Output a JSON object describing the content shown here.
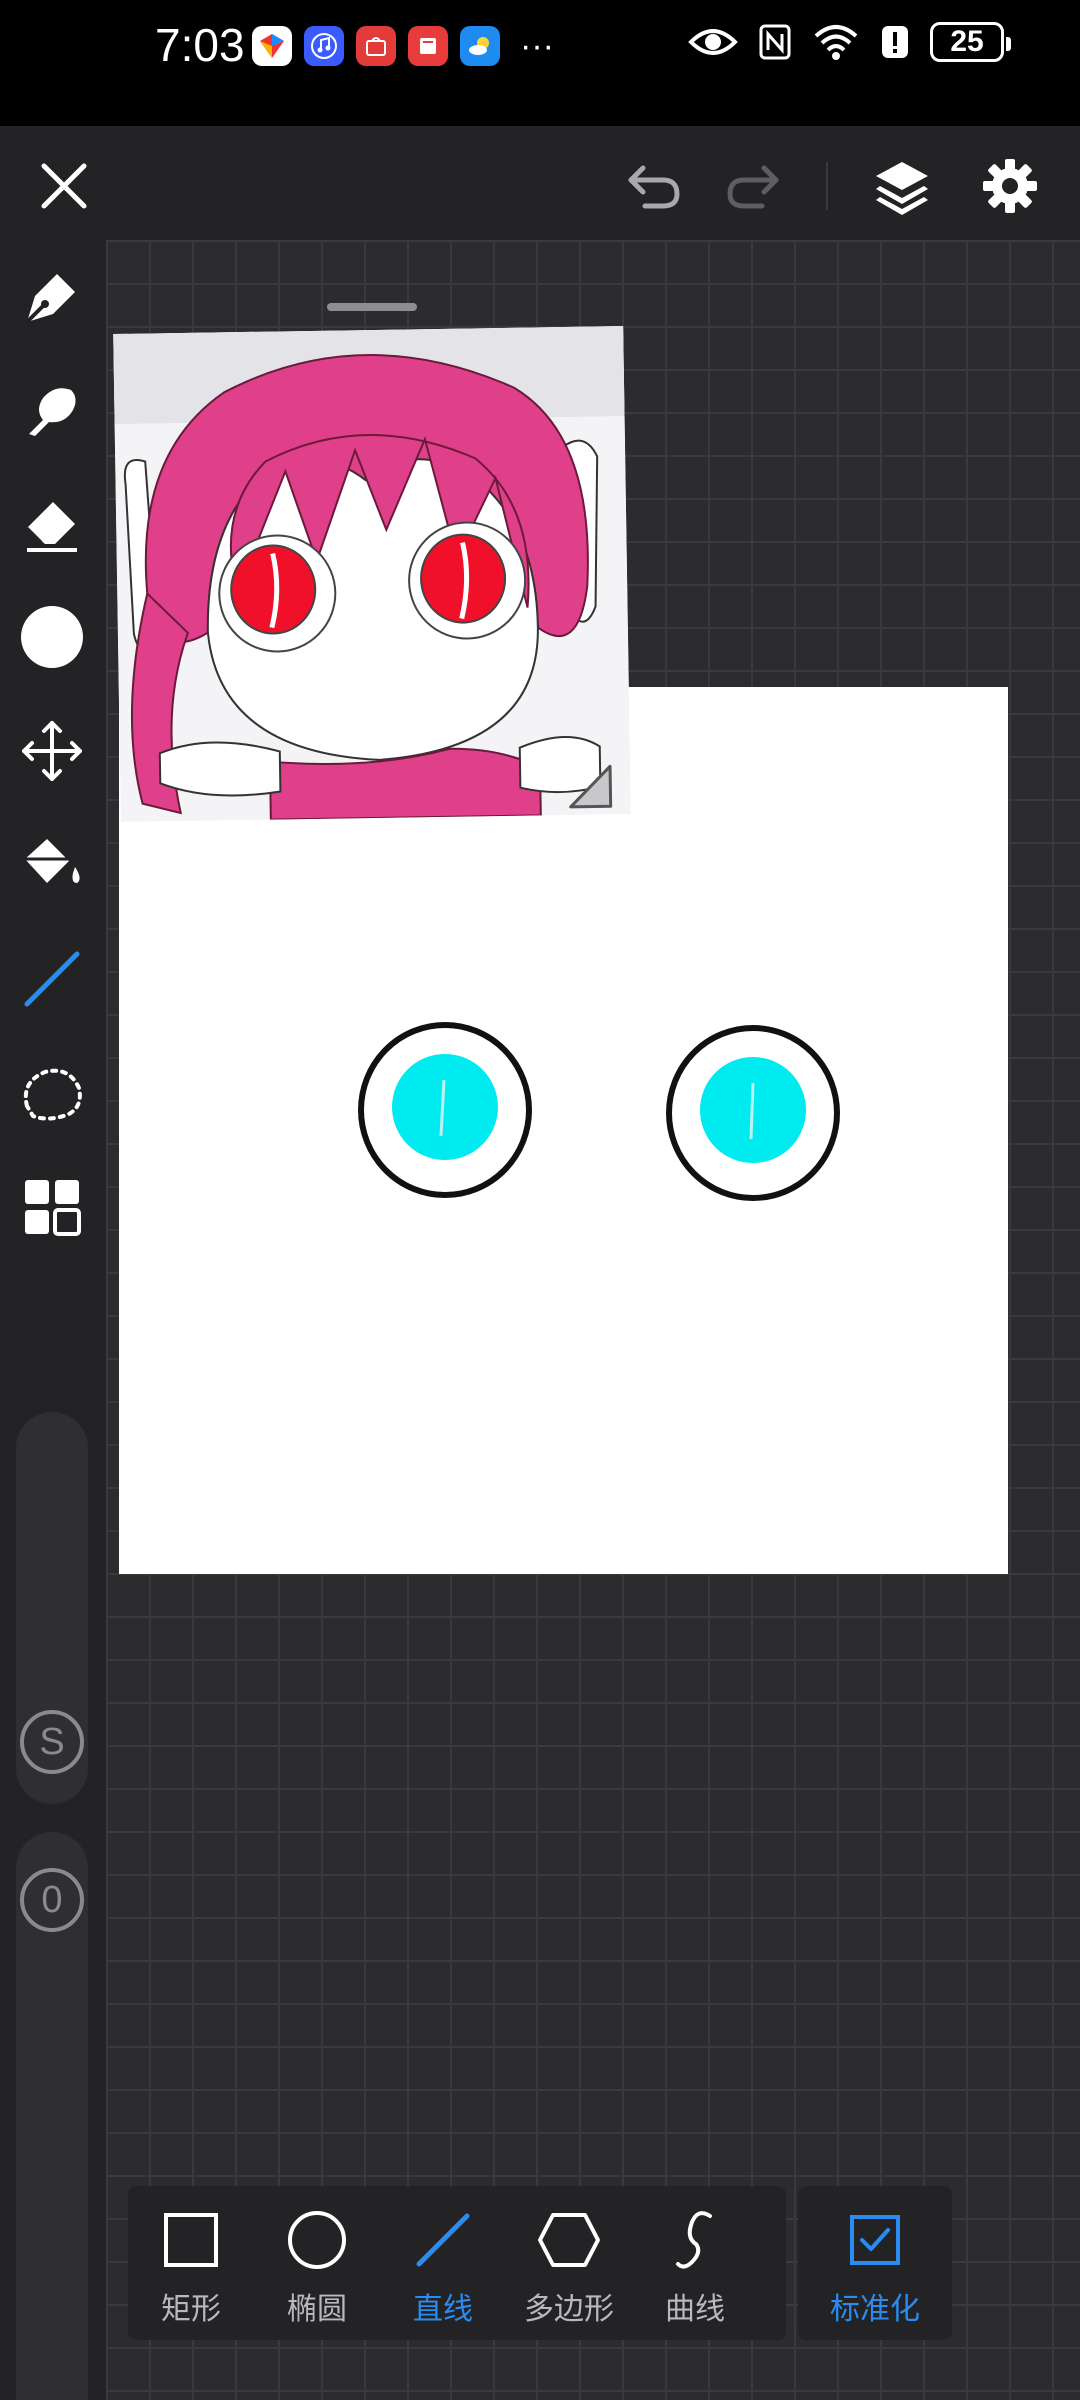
{
  "status": {
    "time": "7:03",
    "more": "···",
    "battery": "25"
  },
  "topbar": {
    "close_icon": "close-icon",
    "undo_icon": "undo-icon",
    "redo_icon": "redo-icon",
    "layers_icon": "layers-icon",
    "settings_icon": "gear-icon"
  },
  "tools": [
    {
      "name": "pen-icon"
    },
    {
      "name": "smudge-icon"
    },
    {
      "name": "eraser-icon"
    },
    {
      "name": "color-swatch"
    },
    {
      "name": "move-icon"
    },
    {
      "name": "fill-bucket-icon"
    },
    {
      "name": "line-tool-icon"
    },
    {
      "name": "lasso-select-icon"
    },
    {
      "name": "grid-menu-icon"
    }
  ],
  "sliders": {
    "size_label": "S",
    "opacity_label": "0"
  },
  "shapes": [
    {
      "label": "矩形",
      "icon": "rectangle-icon"
    },
    {
      "label": "椭圆",
      "icon": "ellipse-icon"
    },
    {
      "label": "直线",
      "icon": "line-icon",
      "active": true
    },
    {
      "label": "多边形",
      "icon": "polygon-icon"
    },
    {
      "label": "曲线",
      "icon": "curve-icon"
    }
  ],
  "standardize": {
    "label": "标准化",
    "checked": true
  },
  "colors": {
    "accent": "#2a8cf0",
    "panel": "#232325",
    "canvas_bg": "#2c2c2e",
    "eye_fill": "#00ebf0",
    "ref_hair": "#e0408a",
    "ref_eye": "#f0102a"
  }
}
